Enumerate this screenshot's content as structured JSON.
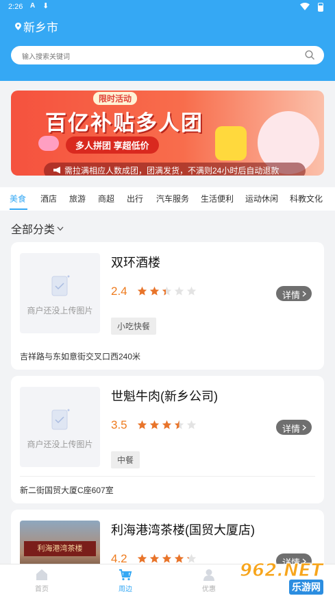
{
  "status_bar": {
    "time": "2:26",
    "notif_a": "A",
    "notif_download": "⬇"
  },
  "header": {
    "city": "新乡市",
    "search_placeholder": "输入搜索关键词"
  },
  "banner": {
    "tag": "限时活动",
    "headline": "百亿补贴多人团",
    "subline": "多人拼团 享超低价",
    "notice": "需拉满相应人数成团，团满发货，不满则24小时后自动退款"
  },
  "tabs": [
    "美食",
    "酒店",
    "旅游",
    "商超",
    "出行",
    "汽车服务",
    "生活便利",
    "运动休闲",
    "科教文化"
  ],
  "active_tab": 0,
  "category_toggle": "全部分类",
  "placeholder_text": "商户还没上传图片",
  "detail_label": "详情",
  "listings": [
    {
      "name": "双环酒楼",
      "rating": "2.4",
      "rating_value": 2.4,
      "category": "小吃快餐",
      "address": "吉祥路与东如意街交叉口西240米",
      "photo": false
    },
    {
      "name": "世魁牛肉(新乡公司)",
      "rating": "3.5",
      "rating_value": 3.5,
      "category": "中餐",
      "address": "新二街国贸大厦C座607室",
      "photo": false
    },
    {
      "name": "利海港湾茶楼(国贸大厦店)",
      "rating": "4.2",
      "rating_value": 4.2,
      "category": "",
      "address": "",
      "photo": true,
      "photo_sign": "利海港湾茶楼"
    }
  ],
  "bottom_nav": [
    {
      "label": "首页",
      "icon": "home-icon"
    },
    {
      "label": "周边",
      "icon": "cart-icon"
    },
    {
      "label": "优惠",
      "icon": "user-icon"
    }
  ],
  "active_nav": 1,
  "watermark": {
    "brand": "962.NET",
    "site": "乐游网"
  },
  "colors": {
    "accent": "#35a8f4",
    "rating": "#ee7b1e",
    "star_on": "#e8742a",
    "star_off": "#e3e3e3"
  }
}
